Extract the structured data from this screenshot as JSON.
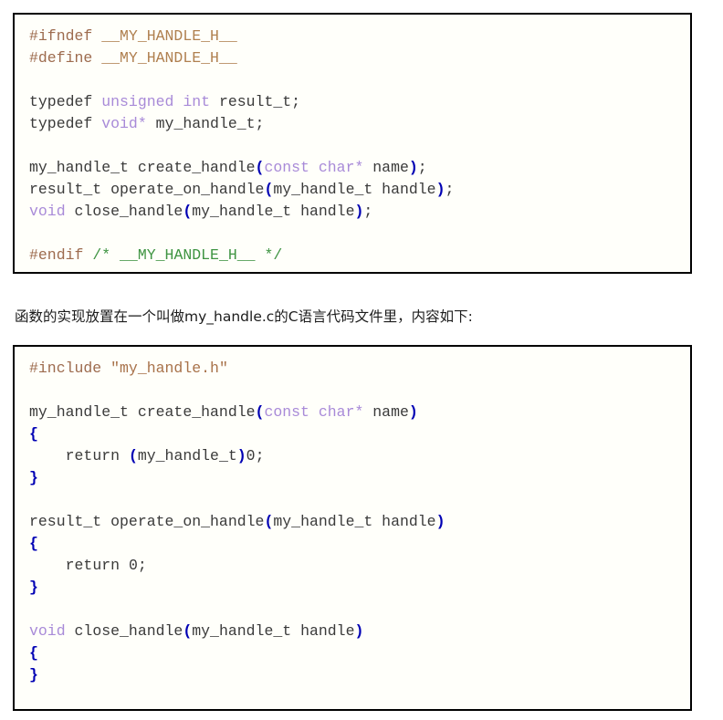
{
  "colors": {
    "page_background": "#ffffff",
    "code_background": "#fffffa",
    "code_border": "#000000",
    "preprocessor": "#9d6b4e",
    "macro_name": "#b08050",
    "string_literal": "#a8724a",
    "comment": "#3f9442",
    "keyword": "#0000b4",
    "type": "#a88ad8",
    "punctuation": "#0000b4",
    "plain_text": "#3a3a3a",
    "prose_text": "#1c1c1c"
  },
  "header_block": {
    "name": "my_handle.h",
    "lines": [
      {
        "tokens": [
          {
            "t": "#ifndef",
            "c": "pre"
          },
          {
            "t": " ",
            "c": "plain"
          },
          {
            "t": "__MY_HANDLE_H__",
            "c": "macro"
          }
        ]
      },
      {
        "tokens": [
          {
            "t": "#define",
            "c": "pre"
          },
          {
            "t": " ",
            "c": "plain"
          },
          {
            "t": "__MY_HANDLE_H__",
            "c": "macro"
          }
        ]
      },
      {
        "tokens": []
      },
      {
        "tokens": [
          {
            "t": "typedef",
            "c": "keyword"
          },
          {
            "t": " ",
            "c": "plain"
          },
          {
            "t": "unsigned int",
            "c": "type"
          },
          {
            "t": " result_t;",
            "c": "plain"
          }
        ]
      },
      {
        "tokens": [
          {
            "t": "typedef",
            "c": "keyword"
          },
          {
            "t": " ",
            "c": "plain"
          },
          {
            "t": "void*",
            "c": "type"
          },
          {
            "t": " my_handle_t;",
            "c": "plain"
          }
        ]
      },
      {
        "tokens": []
      },
      {
        "tokens": [
          {
            "t": "my_handle_t create_handle",
            "c": "plain"
          },
          {
            "t": "(",
            "c": "punct"
          },
          {
            "t": "const char*",
            "c": "type"
          },
          {
            "t": " name",
            "c": "plain"
          },
          {
            "t": ")",
            "c": "punct"
          },
          {
            "t": ";",
            "c": "plain"
          }
        ]
      },
      {
        "tokens": [
          {
            "t": "result_t operate_on_handle",
            "c": "plain"
          },
          {
            "t": "(",
            "c": "punct"
          },
          {
            "t": "my_handle_t handle",
            "c": "plain"
          },
          {
            "t": ")",
            "c": "punct"
          },
          {
            "t": ";",
            "c": "plain"
          }
        ]
      },
      {
        "tokens": [
          {
            "t": "void",
            "c": "type"
          },
          {
            "t": " close_handle",
            "c": "plain"
          },
          {
            "t": "(",
            "c": "punct"
          },
          {
            "t": "my_handle_t handle",
            "c": "plain"
          },
          {
            "t": ")",
            "c": "punct"
          },
          {
            "t": ";",
            "c": "plain"
          }
        ]
      },
      {
        "tokens": []
      },
      {
        "tokens": [
          {
            "t": "#endif",
            "c": "pre"
          },
          {
            "t": " ",
            "c": "plain"
          },
          {
            "t": "/* __MY_HANDLE_H__ */",
            "c": "comment"
          }
        ]
      }
    ]
  },
  "caption": {
    "text": "函数的实现放置在一个叫做my_handle.c的C语言代码文件里，内容如下:"
  },
  "source_block": {
    "name": "my_handle.c",
    "lines": [
      {
        "tokens": [
          {
            "t": "#include",
            "c": "pre"
          },
          {
            "t": " ",
            "c": "plain"
          },
          {
            "t": "\"my_handle.h\"",
            "c": "string"
          }
        ]
      },
      {
        "tokens": []
      },
      {
        "tokens": [
          {
            "t": "my_handle_t create_handle",
            "c": "plain"
          },
          {
            "t": "(",
            "c": "punct"
          },
          {
            "t": "const char*",
            "c": "type"
          },
          {
            "t": " name",
            "c": "plain"
          },
          {
            "t": ")",
            "c": "punct"
          }
        ]
      },
      {
        "tokens": [
          {
            "t": "{",
            "c": "punct"
          }
        ]
      },
      {
        "tokens": [
          {
            "t": "    ",
            "c": "plain"
          },
          {
            "t": "return",
            "c": "keyword"
          },
          {
            "t": " ",
            "c": "plain"
          },
          {
            "t": "(",
            "c": "punct"
          },
          {
            "t": "my_handle_t",
            "c": "plain"
          },
          {
            "t": ")",
            "c": "punct"
          },
          {
            "t": "0;",
            "c": "num"
          }
        ]
      },
      {
        "tokens": [
          {
            "t": "}",
            "c": "punct"
          }
        ]
      },
      {
        "tokens": []
      },
      {
        "tokens": [
          {
            "t": "result_t operate_on_handle",
            "c": "plain"
          },
          {
            "t": "(",
            "c": "punct"
          },
          {
            "t": "my_handle_t handle",
            "c": "plain"
          },
          {
            "t": ")",
            "c": "punct"
          }
        ]
      },
      {
        "tokens": [
          {
            "t": "{",
            "c": "punct"
          }
        ]
      },
      {
        "tokens": [
          {
            "t": "    ",
            "c": "plain"
          },
          {
            "t": "return",
            "c": "keyword"
          },
          {
            "t": " ",
            "c": "plain"
          },
          {
            "t": "0;",
            "c": "num"
          }
        ]
      },
      {
        "tokens": [
          {
            "t": "}",
            "c": "punct"
          }
        ]
      },
      {
        "tokens": []
      },
      {
        "tokens": [
          {
            "t": "void",
            "c": "type"
          },
          {
            "t": " close_handle",
            "c": "plain"
          },
          {
            "t": "(",
            "c": "punct"
          },
          {
            "t": "my_handle_t handle",
            "c": "plain"
          },
          {
            "t": ")",
            "c": "punct"
          }
        ]
      },
      {
        "tokens": [
          {
            "t": "{",
            "c": "punct"
          }
        ]
      },
      {
        "tokens": [
          {
            "t": "}",
            "c": "punct"
          }
        ]
      }
    ]
  }
}
